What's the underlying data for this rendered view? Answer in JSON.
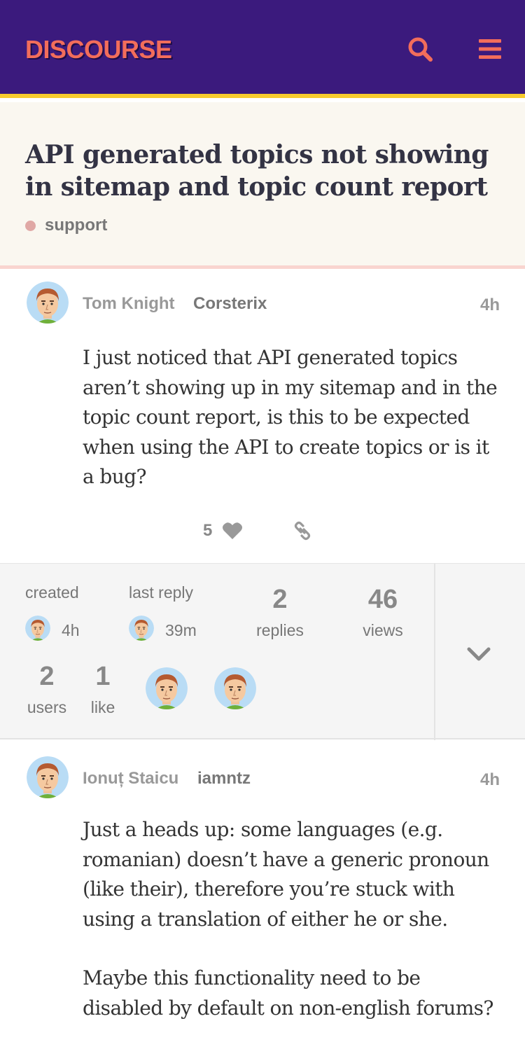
{
  "header": {
    "logo": "DISCOURSE",
    "search_icon": "search-icon",
    "menu_icon": "hamburger-menu-icon"
  },
  "topic": {
    "title": "API generated topics not showing in sitemap and topic count report",
    "category": "support",
    "category_color": "#e0a8a5"
  },
  "posts": [
    {
      "full_name": "Tom Knight",
      "username": "Corsterix",
      "time": "4h",
      "paragraphs": [
        "I just noticed that API generated topics aren’t showing up in my sitemap and in the topic count report, is this to be expected when using the API to create topics or is it a bug?"
      ],
      "like_count": "5"
    },
    {
      "full_name": "Ionuț Staicu",
      "username": "iamntz",
      "time": "4h",
      "paragraphs": [
        "Just a heads up: some languages (e.g. romanian) doesn’t have a generic pronoun (like their), therefore you’re stuck with using a translation of either he or she.",
        "Maybe this functionality need to be disabled by default on non-english forums?"
      ]
    }
  ],
  "topic_map": {
    "created_label": "created",
    "created_time": "4h",
    "last_reply_label": "last reply",
    "last_reply_time": "39m",
    "replies_count": "2",
    "replies_label": "replies",
    "views_count": "46",
    "views_label": "views",
    "users_count": "2",
    "users_label": "users",
    "likes_count": "1",
    "likes_label": "like"
  },
  "colors": {
    "header_bg": "#3b1a7d",
    "header_accent": "#f7cb2d",
    "brand": "#f26d5b",
    "title_bg": "#faf7f0"
  }
}
